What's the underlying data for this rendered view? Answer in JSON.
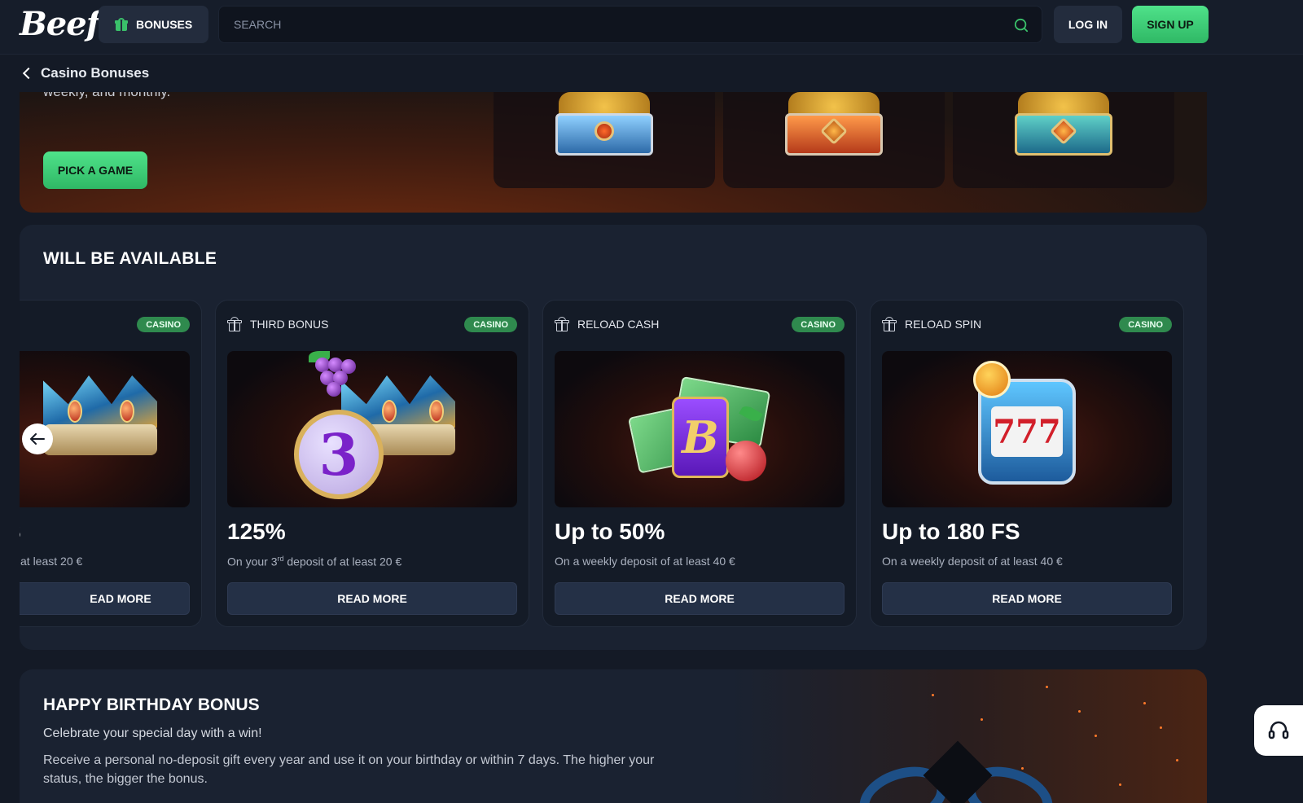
{
  "header": {
    "logo": "Beef",
    "bonuses_label": "BONUSES",
    "search_placeholder": "SEARCH",
    "login_label": "LOG IN",
    "signup_label": "SIGN UP"
  },
  "breadcrumb": {
    "label": "Casino Bonuses"
  },
  "hero": {
    "text_fragment": "weekly, and monthly.",
    "pick_game_label": "PICK A GAME"
  },
  "available": {
    "title": "WILL BE AVAILABLE",
    "cards": [
      {
        "title": "",
        "badge": "CASINO",
        "value": "S",
        "desc": "at least 20 €",
        "button": "EAD MORE"
      },
      {
        "title": "THIRD BONUS",
        "badge": "CASINO",
        "value": "125%",
        "desc_pre": "On your 3",
        "desc_sup": "rd",
        "desc_post": " deposit of at least 20 €",
        "button": "READ MORE"
      },
      {
        "title": "RELOAD CASH",
        "badge": "CASINO",
        "value": "Up to 50%",
        "desc": "On a weekly deposit of at least 40 €",
        "button": "READ MORE"
      },
      {
        "title": "RELOAD SPIN",
        "badge": "CASINO",
        "value": "Up to 180 FS",
        "desc": "On a weekly deposit of at least 40 €",
        "button": "READ MORE"
      }
    ]
  },
  "birthday": {
    "title": "HAPPY BIRTHDAY BONUS",
    "subtitle": "Celebrate your special day with a win!",
    "text": "Receive a personal no-deposit gift every year and use it on your birthday or within 7 days. The higher your status, the bigger the bonus."
  },
  "colors": {
    "accent_green": "#3ac06a",
    "badge_green": "#2f8a4e",
    "background": "#141a26"
  },
  "icons": [
    "gift-icon",
    "search-icon",
    "chevron-left-icon",
    "arrow-left-icon",
    "headset-icon"
  ]
}
